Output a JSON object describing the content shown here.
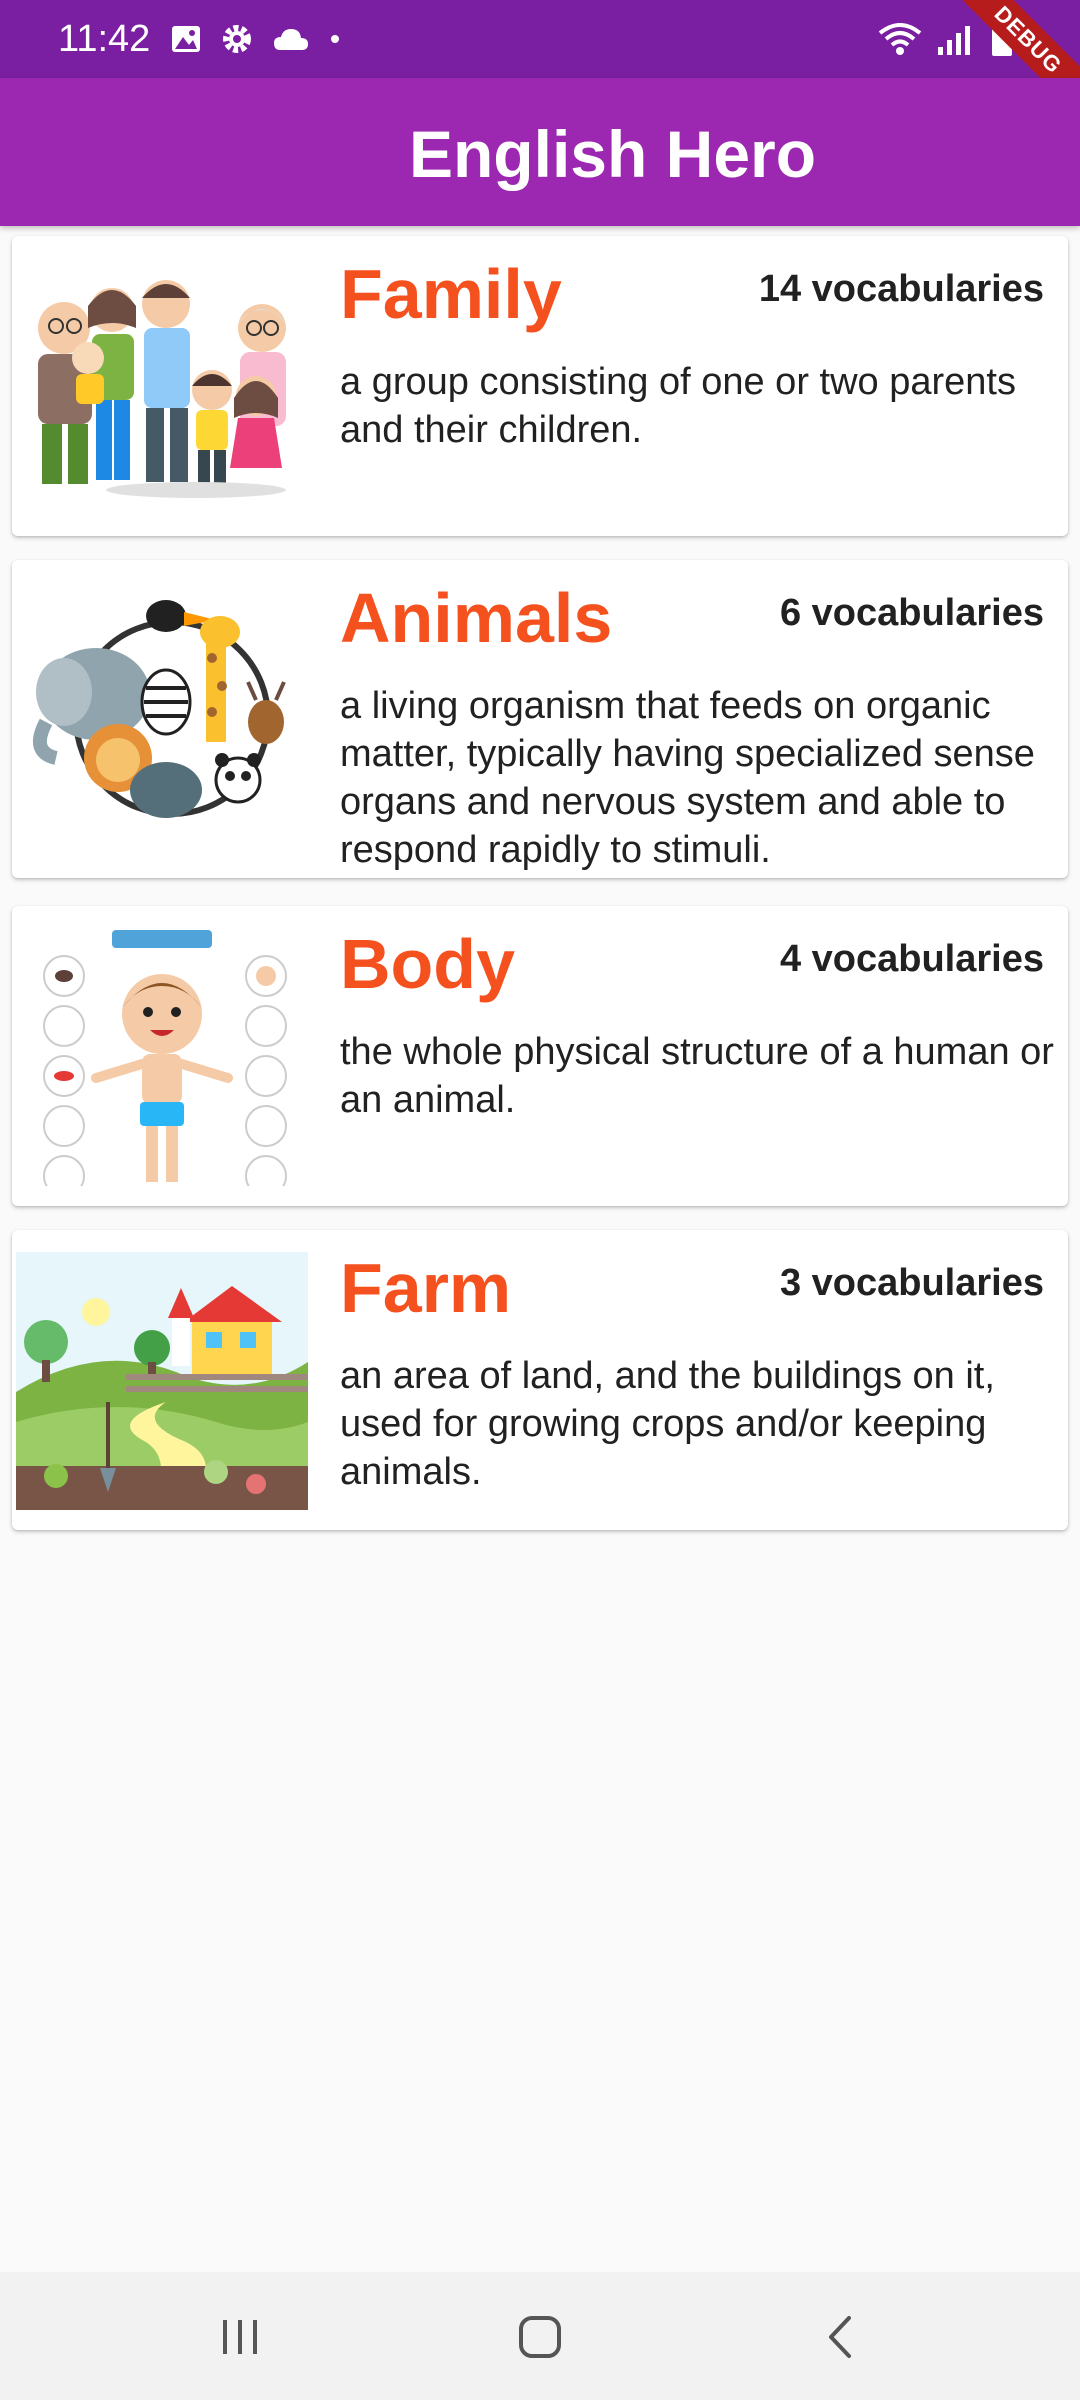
{
  "status_bar": {
    "time": "11:42",
    "left_icons": [
      "image-icon",
      "settings-gear-icon",
      "cloud-icon",
      "dot-icon"
    ],
    "right_icons": [
      "wifi-icon",
      "signal-icon",
      "battery-icon"
    ],
    "debug_label": "DEBUG"
  },
  "app_bar": {
    "title": "English Hero"
  },
  "topics": [
    {
      "title": "Family",
      "count": "14 vocabularies",
      "description": "a group consisting of one or two parents and their children.",
      "image": "family-illustration"
    },
    {
      "title": "Animals",
      "count": "6 vocabularies",
      "description": "a living organism that feeds on organic matter, typically having specialized sense organs and nervous system and able to respond rapidly to stimuli.",
      "image": "animals-illustration"
    },
    {
      "title": "Body",
      "count": "4 vocabularies",
      "description": "the whole physical structure of a human or an animal.",
      "image": "body-parts-illustration"
    },
    {
      "title": "Farm",
      "count": "3 vocabularies",
      "description": "an area of land, and the buildings on it, used for growing crops and/or keeping animals.",
      "image": "farm-illustration"
    }
  ],
  "nav_bar": {
    "buttons": [
      "recent-apps-icon",
      "home-icon",
      "back-icon"
    ]
  },
  "colors": {
    "status_bar": "#7b1fa2",
    "app_bar": "#9c27b0",
    "title_accent": "#f4511e"
  }
}
